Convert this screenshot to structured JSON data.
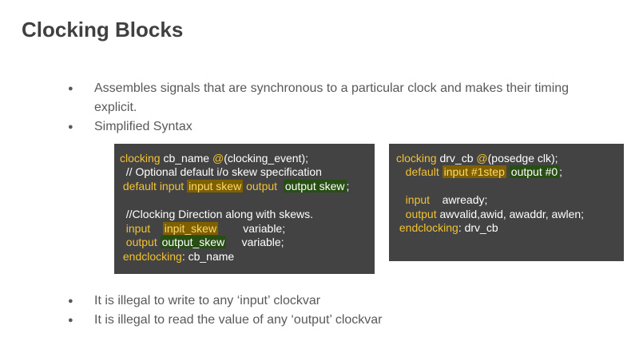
{
  "title": "Clocking Blocks",
  "bullets_top": [
    "Assembles signals that are synchronous to a particular clock and makes their timing explicit.",
    "Simplified Syntax"
  ],
  "code_left": {
    "l1_kw": "clocking",
    "l1_text": " cb_name ",
    "l1_at": "@",
    "l1_rest": "(clocking_event);",
    "l2": "  // Optional default i/o skew specification",
    "l3_kw1": " default input ",
    "l3_hl1": "input skew",
    "l3_kw2": " output ",
    "l3_hl2": "output skew",
    "l3_end": ";",
    "l5": "  //Clocking Direction along with skews.",
    "l6_kw": "  input    ",
    "l6_hl": "inpit_skew",
    "l6_rest": "        variable;",
    "l7_kw": "  output ",
    "l7_hl": "output_skew",
    "l7_rest": "     variable;",
    "l8_kw": " endclocking",
    "l8_rest": ": cb_name"
  },
  "code_right": {
    "l1_kw": "clocking",
    "l1_text": " drv_cb ",
    "l1_at": "@",
    "l1_rest": "(posedge clk);",
    "l2_kw": "   default ",
    "l2_hl1": "input #1step",
    "l2_hl2": "output #0",
    "l2_end": ";",
    "l4_kw": "   input",
    "l4_rest": "    awready;",
    "l5_kw": "   output",
    "l5_rest": " awvalid,awid, awaddr, awlen;",
    "l6_kw": " endclocking",
    "l6_rest": ": drv_cb"
  },
  "bullets_bottom": [
    "It is illegal to write to any ‘input’ clockvar",
    "It is illegal to read the value of any ‘output’  clockvar"
  ]
}
